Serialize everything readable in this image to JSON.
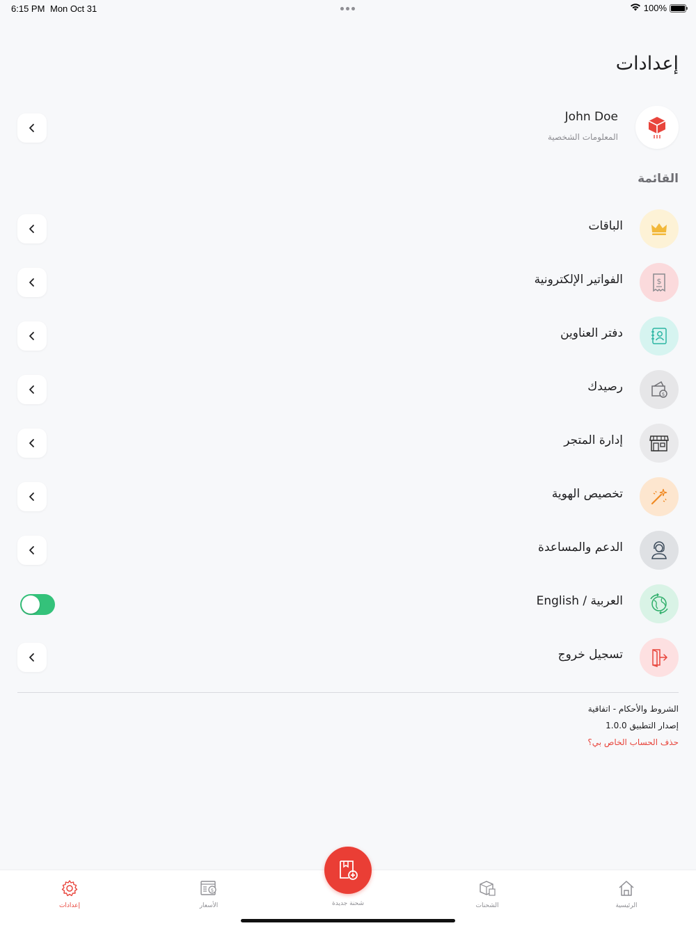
{
  "status_bar": {
    "time": "6:15 PM",
    "date": "Mon Oct 31",
    "battery": "100%",
    "battery_level": 1.0
  },
  "page": {
    "title": "إعدادات"
  },
  "profile": {
    "name": "John Doe",
    "subtitle": "المعلومات الشخصية",
    "avatar_icon": "cube-logo-icon"
  },
  "menu": {
    "title": "القائمة",
    "items": [
      {
        "label": "الباقات",
        "icon": "crown-icon",
        "bg": "#fdf2d6",
        "color": "#f2b83a"
      },
      {
        "label": "الفواتير الإلكترونية",
        "icon": "invoice-icon",
        "bg": "#fbdadc",
        "color": "#8a8a8e"
      },
      {
        "label": "دفتر العناوين",
        "icon": "address-book-icon",
        "bg": "#d6f4f0",
        "color": "#2bb5a3"
      },
      {
        "label": "رصيدك",
        "icon": "wallet-icon",
        "bg": "#e6e6e8",
        "color": "#6e6e73"
      },
      {
        "label": "إدارة المتجر",
        "icon": "store-icon",
        "bg": "#e9e9eb",
        "color": "#333333"
      },
      {
        "label": "تخصيص الهوية",
        "icon": "magic-wand-icon",
        "bg": "#fde6cf",
        "color": "#f08a24"
      },
      {
        "label": "الدعم والمساعدة",
        "icon": "support-agent-icon",
        "bg": "#dfe1e4",
        "color": "#3b4a5a"
      },
      {
        "label": "العربية / English",
        "icon": "language-globe-icon",
        "bg": "#d9f3e6",
        "color": "#2eae6a",
        "toggle_on": true
      },
      {
        "label": "تسجيل خروج",
        "icon": "logout-icon",
        "bg": "#fde0e1",
        "color": "#e8453c"
      }
    ]
  },
  "footer": {
    "terms": "الشروط والأحكام - اتفاقية",
    "version": "إصدار التطبيق 1.0.0",
    "delete_account": "حذف الحساب الخاص بي؟"
  },
  "tabbar": {
    "settings": "إعدادات",
    "prices": "الأسعار",
    "new_shipment": "شحنة جديدة",
    "shipments": "الشحنات",
    "home": "الرئيسية",
    "active": "settings",
    "accent": "#e8453c"
  }
}
